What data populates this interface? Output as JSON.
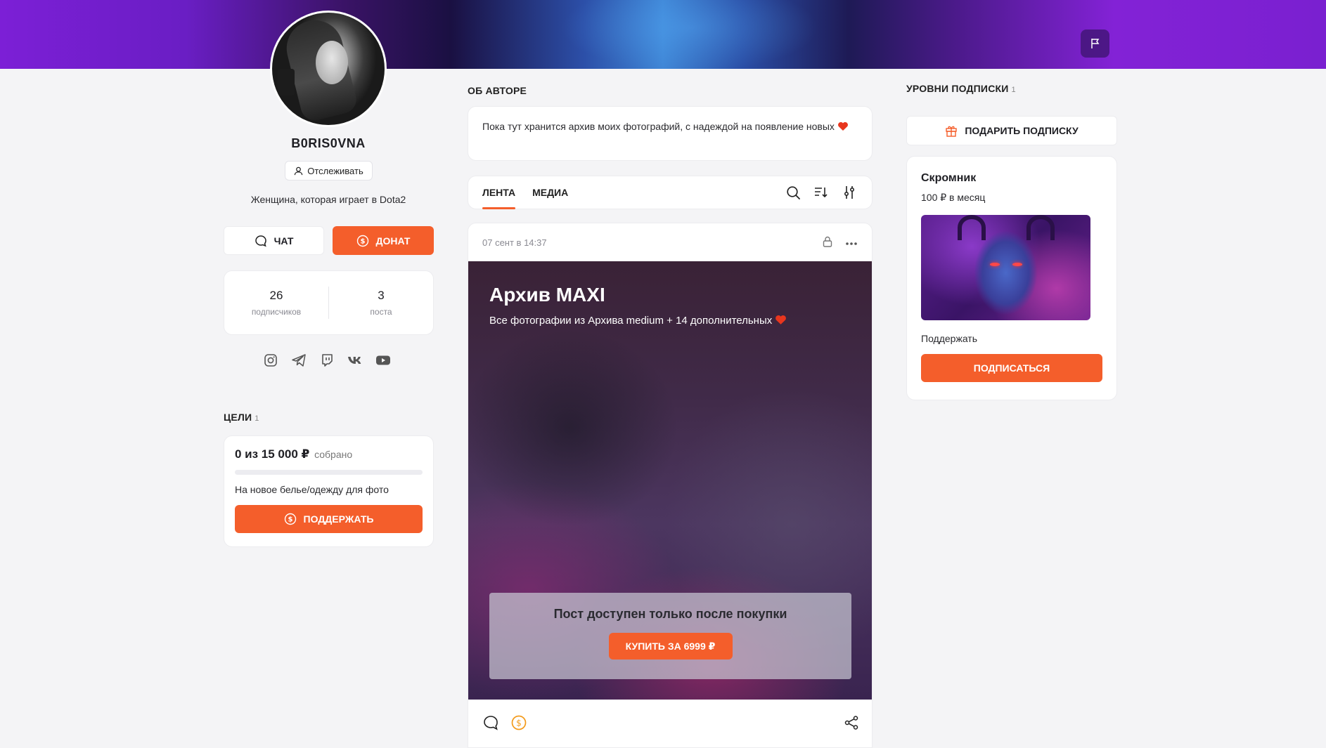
{
  "profile": {
    "username": "B0RIS0VNA",
    "follow_label": "Отслеживать",
    "bio": "Женщина, которая играет в Dota2",
    "chat_label": "ЧАТ",
    "donate_label": "ДОНАТ",
    "stats": [
      {
        "value": "26",
        "label": "подписчиков"
      },
      {
        "value": "3",
        "label": "поста"
      }
    ],
    "socials": [
      "instagram-icon",
      "telegram-icon",
      "twitch-icon",
      "vk-icon",
      "youtube-icon"
    ]
  },
  "goals": {
    "title": "ЦЕЛИ",
    "count": "1",
    "amount_text": "0 из 15 000 ₽",
    "collected_label": "собрано",
    "progress": 0,
    "description": "На новое белье/одежду для фото",
    "support_label": "ПОДДЕРЖАТЬ"
  },
  "about": {
    "title": "ОБ АВТОРЕ",
    "text": "Пока тут хранится архив моих фотографий, с надеждой на появление новых"
  },
  "feed": {
    "tabs": [
      {
        "label": "ЛЕНТА",
        "active": true
      },
      {
        "label": "МЕДИА",
        "active": false
      }
    ],
    "tools": [
      "search-icon",
      "sort-icon",
      "filter-icon"
    ]
  },
  "post": {
    "date": "07 сент в 14:37",
    "title": "Архив MAXI",
    "subtitle": "Все фотографии из Архива medium + 14 дополнительных",
    "paywall_text": "Пост доступен только после покупки",
    "buy_label": "КУПИТЬ ЗА 6999 ₽"
  },
  "tiers": {
    "title": "УРОВНИ ПОДПИСКИ",
    "count": "1",
    "gift_label": "ПОДАРИТЬ ПОДПИСКУ",
    "items": [
      {
        "name": "Скромник",
        "price": "100 ₽ в месяц",
        "description": "Поддержать",
        "subscribe_label": "ПОДПИСАТЬСЯ"
      }
    ]
  },
  "colors": {
    "accent": "#f45e2b",
    "heart": "#e8361e"
  }
}
